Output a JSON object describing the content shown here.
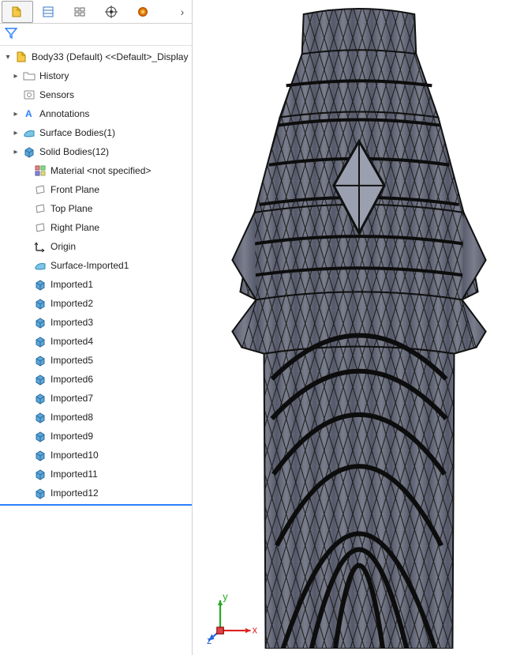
{
  "root": {
    "label": "Body33 (Default) <<Default>_Display"
  },
  "items": {
    "history": "History",
    "sensors": "Sensors",
    "annotations": "Annotations",
    "surface_bodies": "Surface Bodies(1)",
    "solid_bodies": "Solid Bodies(12)",
    "material": "Material <not specified>",
    "front_plane": "Front Plane",
    "top_plane": "Top Plane",
    "right_plane": "Right Plane",
    "origin": "Origin",
    "surface_imported1": "Surface-Imported1"
  },
  "imported": [
    "Imported1",
    "Imported2",
    "Imported3",
    "Imported4",
    "Imported5",
    "Imported6",
    "Imported7",
    "Imported8",
    "Imported9",
    "Imported10",
    "Imported11",
    "Imported12"
  ],
  "triad": {
    "x": "x",
    "y": "y",
    "z": "z"
  },
  "colors": {
    "model_fill": "#6a6e7a",
    "model_edge": "#1a1a1a"
  }
}
